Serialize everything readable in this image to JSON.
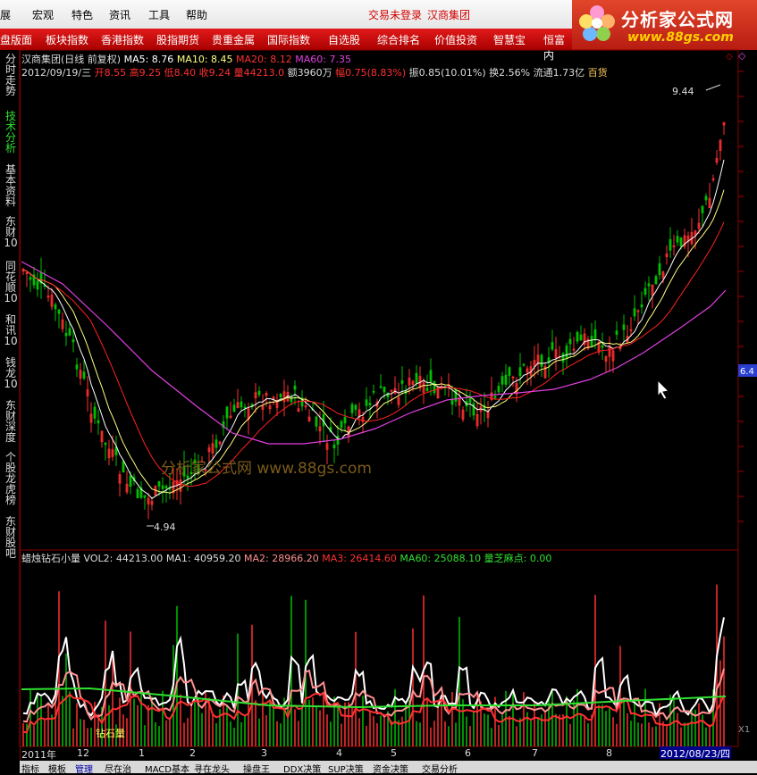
{
  "menu": {
    "items": [
      "展",
      "宏观",
      "特色",
      "资讯",
      "工具",
      "帮助"
    ],
    "status_login": "交易未登录",
    "status_stock": "汉商集团"
  },
  "logo": {
    "brand": "分析家公式网",
    "url": "www.88gs.com"
  },
  "nav": {
    "items": [
      "盘版面",
      "板块指数",
      "香港指数",
      "股指期货",
      "贵重金属",
      "国际指数",
      "自选股",
      "综合排名",
      "价值投资",
      "智慧宝",
      "恒富内"
    ]
  },
  "side_tabs": [
    "分时走势",
    "技术分析",
    "基本资料",
    "东财10",
    "同花顺10",
    "和讯10",
    "钱龙10",
    "东财深度",
    "个股龙虎榜",
    "东财股吧"
  ],
  "price_header": {
    "line1": {
      "name": "汉商集团(日线 前复权)",
      "ma5": "MA5: 8.76",
      "ma10": "MA10: 8.45",
      "ma20": "MA20: 8.12",
      "ma60": "MA60: 7.35"
    },
    "line2": {
      "date": "2012/09/19/三",
      "open": "开8.55",
      "high": "高9.25",
      "low": "低8.40",
      "close": "收9.24",
      "vol": "量44213.0",
      "amount": "额3960万",
      "range": "幅0.75(8.83%)",
      "amp": "振0.85(10.01%)",
      "turnover": "换2.56%",
      "float": "流通1.73亿",
      "cat": "百货"
    }
  },
  "annotations": {
    "high": "9.44",
    "low": "4.94",
    "watermark": "分析家公式网 www.88gs.com",
    "right_price": "6.4",
    "vol_label": "钻石量",
    "x1": "X1"
  },
  "vol_header": {
    "name": "蜡烛钻石小量",
    "vol2": "VOL2: 44213.00",
    "ma1": "MA1: 40959.20",
    "ma2": "MA2: 28966.20",
    "ma3": "MA3: 26414.60",
    "ma60": "MA60: 25088.10",
    "zhima": "量芝麻点: 0.00"
  },
  "time_axis": {
    "year": "2011年",
    "months": [
      "12",
      "1",
      "2",
      "3",
      "4",
      "5",
      "6",
      "7",
      "8"
    ],
    "current_date": "2012/08/23/四"
  },
  "bottom_tabs": [
    "指标",
    "模板",
    "管理",
    "尽在治",
    "MACD基本",
    "寻在龙头",
    "操盘王",
    "DDX决策",
    "SUP决策",
    "资金决策",
    "交易分析"
  ],
  "colors": {
    "up": "#ff3030",
    "down": "#00c000",
    "ma5": "#ffffff",
    "ma10": "#ffff80",
    "ma20": "#ff2020",
    "ma60": "#e040e0",
    "vol_ma_green": "#30e030"
  }
}
